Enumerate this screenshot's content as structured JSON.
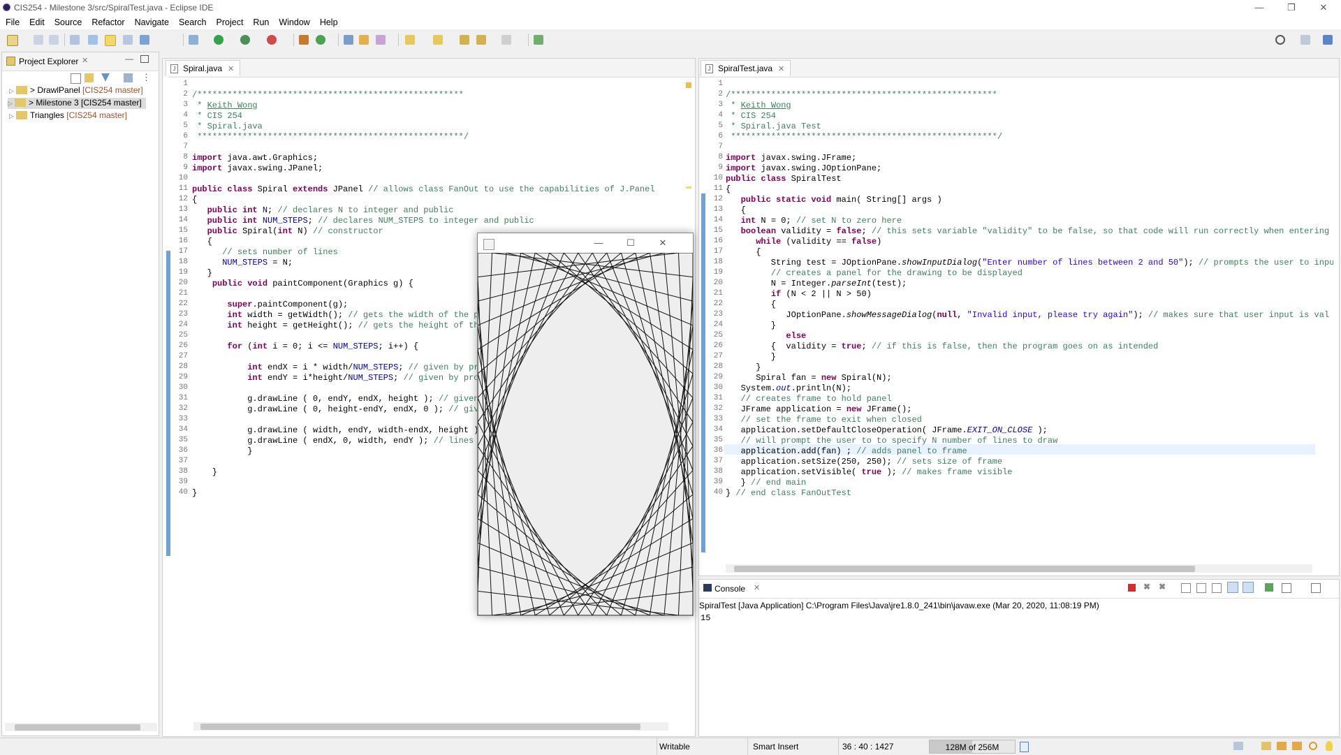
{
  "window": {
    "title": "CIS254 - Milestone 3/src/SpiralTest.java - Eclipse IDE"
  },
  "menu": [
    "File",
    "Edit",
    "Source",
    "Refactor",
    "Navigate",
    "Search",
    "Project",
    "Run",
    "Window",
    "Help"
  ],
  "explorer": {
    "title": "Project Explorer",
    "items": [
      {
        "label": "> DrawlPanel",
        "tag": "[CIS254 master]"
      },
      {
        "label": "> Milestone 3 [CIS254 master]",
        "tag": ""
      },
      {
        "label": "Triangles",
        "tag": "[CIS254 master]"
      }
    ]
  },
  "left_editor": {
    "tab": "Spiral.java",
    "lines": [
      {
        "n": "1",
        "h": ""
      },
      {
        "n": "2",
        "h": "<span class='cm'>/*****************************************************</span>"
      },
      {
        "n": "3",
        "h": "<span class='cm'> * <u>Keith Wong</u></span>"
      },
      {
        "n": "4",
        "h": "<span class='cm'> * CIS 254</span>"
      },
      {
        "n": "5",
        "h": "<span class='cm'> * Spiral.java</span>"
      },
      {
        "n": "6",
        "h": "<span class='cm'> *****************************************************/</span>"
      },
      {
        "n": "7",
        "h": ""
      },
      {
        "n": "8",
        "h": "<span class='kw'>import</span> java.awt.Graphics;"
      },
      {
        "n": "9",
        "h": "<span class='kw'>import</span> javax.swing.JPanel;"
      },
      {
        "n": "10",
        "h": ""
      },
      {
        "n": "11",
        "h": "<span class='kw'>public class</span> Spiral <span class='kw'>extends</span> JPanel <span class='cm'>// allows class FanOut to use the capabilities of J.Panel</span>"
      },
      {
        "n": "12",
        "h": "{"
      },
      {
        "n": "13",
        "h": "   <span class='kw'>public int</span> <span class='fld'>N</span>; <span class='cm'>// declares N to integer and public</span>"
      },
      {
        "n": "14",
        "h": "   <span class='kw'>public int</span> <span class='fld'>NUM_STEPS</span>; <span class='cm'>// declares NUM_STEPS to integer and public</span>"
      },
      {
        "n": "15",
        "h": "   <span class='kw'>public</span> Spiral(<span class='kw'>int</span> N) <span class='cm'>// constructor</span>"
      },
      {
        "n": "16",
        "h": "   {"
      },
      {
        "n": "17",
        "h": "      <span class='cm'>// sets number of lines</span>"
      },
      {
        "n": "18",
        "h": "      <span class='fld'>NUM_STEPS</span> = N;"
      },
      {
        "n": "19",
        "h": "   }"
      },
      {
        "n": "20",
        "h": "    <span class='kw'>public void</span> paintComponent(Graphics g) {"
      },
      {
        "n": "21",
        "h": ""
      },
      {
        "n": "22",
        "h": "       <span class='kw'>super</span>.paintComponent(g);"
      },
      {
        "n": "23",
        "h": "       <span class='kw'>int</span> width = getWidth(); <span class='cm'>// gets the width of the p</span>"
      },
      {
        "n": "24",
        "h": "       <span class='kw'>int</span> height = getHeight(); <span class='cm'>// gets the height of th</span>"
      },
      {
        "n": "25",
        "h": ""
      },
      {
        "n": "26",
        "h": "       <span class='kw'>for</span> (<span class='kw'>int</span> i = 0; i &lt;= <span class='fld'>NUM_STEPS</span>; i++) {"
      },
      {
        "n": "27",
        "h": ""
      },
      {
        "n": "28",
        "h": "           <span class='kw'>int</span> endX = i * width/<span class='fld'>NUM_STEPS</span>; <span class='cm'>// given by pr</span>"
      },
      {
        "n": "29",
        "h": "           <span class='kw'>int</span> endY = i*height/<span class='fld'>NUM_STEPS</span>; <span class='cm'>// given by pro</span>"
      },
      {
        "n": "30",
        "h": ""
      },
      {
        "n": "31",
        "h": "           g.drawLine ( 0, endY, endX, height ); <span class='cm'>// given</span>"
      },
      {
        "n": "32",
        "h": "           g.drawLine ( 0, height-endY, endX, 0 ); <span class='cm'>// giv</span>"
      },
      {
        "n": "33",
        "h": ""
      },
      {
        "n": "34",
        "h": "           g.drawLine ( width, endY, width-endX, height )"
      },
      {
        "n": "35",
        "h": "           g.drawLine ( endX, 0, width, endY ); <span class='cm'>// lines</span>"
      },
      {
        "n": "36",
        "h": "           }"
      },
      {
        "n": "37",
        "h": ""
      },
      {
        "n": "38",
        "h": "    }"
      },
      {
        "n": "39",
        "h": ""
      },
      {
        "n": "40",
        "h": "}"
      }
    ]
  },
  "right_editor": {
    "tab": "SpiralTest.java",
    "lines": [
      {
        "n": "1",
        "h": ""
      },
      {
        "n": "2",
        "h": "<span class='cm'>/*****************************************************</span>"
      },
      {
        "n": "3",
        "h": "<span class='cm'> * <u>Keith Wong</u></span>"
      },
      {
        "n": "4",
        "h": "<span class='cm'> * CIS 254</span>"
      },
      {
        "n": "5",
        "h": "<span class='cm'> * Spiral.java Test</span>"
      },
      {
        "n": "6",
        "h": "<span class='cm'> *****************************************************/</span>"
      },
      {
        "n": "7",
        "h": ""
      },
      {
        "n": "8",
        "h": "<span class='kw'>import</span> javax.swing.JFrame;"
      },
      {
        "n": "9",
        "h": "<span class='kw'>import</span> javax.swing.JOptionPane;"
      },
      {
        "n": "10",
        "h": "<span class='kw'>public class</span> SpiralTest"
      },
      {
        "n": "11",
        "h": "{"
      },
      {
        "n": "12",
        "h": "   <span class='kw'>public static void</span> main( String[] args )"
      },
      {
        "n": "13",
        "h": "   {"
      },
      {
        "n": "14",
        "h": "   <span class='kw'>int</span> N = 0; <span class='cm'>// set N to zero here</span>"
      },
      {
        "n": "15",
        "h": "   <span class='kw'>boolean</span> validity = <span class='kw'>false</span>; <span class='cm'>// this sets variable \"validity\" to be false, so that code will run correctly when entering</span>"
      },
      {
        "n": "16",
        "h": "      <span class='kw'>while</span> (validity == <span class='kw'>false</span>)"
      },
      {
        "n": "17",
        "h": "      {"
      },
      {
        "n": "18",
        "h": "         String test = JOptionPane.<span class='it'>showInputDialog</span>(<span class='st'>\"Enter number of lines between 2 and 50\"</span>); <span class='cm'>// prompts the user to inpu</span>"
      },
      {
        "n": "19",
        "h": "         <span class='cm'>// creates a panel for the drawing to be displayed</span>"
      },
      {
        "n": "20",
        "h": "         N = Integer.<span class='it'>parseInt</span>(test);"
      },
      {
        "n": "21",
        "h": "         <span class='kw'>if</span> (N &lt; 2 || N &gt; 50)"
      },
      {
        "n": "22",
        "h": "         {"
      },
      {
        "n": "23",
        "h": "            JOptionPane.<span class='it'>showMessageDialog</span>(<span class='kw'>null</span>, <span class='st'>\"Invalid input, please try again\"</span>); <span class='cm'>// makes sure that user input is val</span>"
      },
      {
        "n": "24",
        "h": "         }"
      },
      {
        "n": "25",
        "h": "            <span class='kw'>else</span>"
      },
      {
        "n": "26",
        "h": "         {  validity = <span class='kw'>true</span>; <span class='cm'>// if this is false, then the program goes on as intended</span>"
      },
      {
        "n": "27",
        "h": "         }"
      },
      {
        "n": "28",
        "h": "      }"
      },
      {
        "n": "29",
        "h": "      Spiral fan = <span class='kw'>new</span> Spiral(N);"
      },
      {
        "n": "30",
        "h": "   System.<span class='fld it'>out</span>.println(N);"
      },
      {
        "n": "31",
        "h": "   <span class='cm'>// creates frame to hold panel</span>"
      },
      {
        "n": "32",
        "h": "   JFrame application = <span class='kw'>new</span> JFrame();"
      },
      {
        "n": "33",
        "h": "   <span class='cm'>// set the frame to exit when closed</span>"
      },
      {
        "n": "34",
        "h": "   application.setDefaultCloseOperation( JFrame.<span class='fld it'>EXIT_ON_CLOSE</span> );"
      },
      {
        "n": "35",
        "h": "   <span class='cm'>// will prompt the user to to specify N number of lines to draw</span>"
      },
      {
        "n": "36",
        "h": "   application.add(fan) ; <span class='cm'>// adds panel to frame</span>"
      },
      {
        "n": "37",
        "h": "   application.setSize(250, 250); <span class='cm'>// sets size of frame</span>"
      },
      {
        "n": "38",
        "h": "   application.setVisible( <span class='kw'>true</span> ); <span class='cm'>// makes frame visible</span>"
      },
      {
        "n": "39",
        "h": "   } <span class='cm'>// end main</span>"
      },
      {
        "n": "40",
        "h": "} <span class='cm'>// end class FanOutTest</span>"
      }
    ]
  },
  "console": {
    "tab": "Console",
    "header": "SpiralTest [Java Application] C:\\Program Files\\Java\\jre1.8.0_241\\bin\\javaw.exe (Mar 20, 2020, 11:08:19 PM)",
    "output": "15"
  },
  "spiral": {
    "steps": 15
  },
  "status": {
    "writable": "Writable",
    "insert": "Smart Insert",
    "position": "36 : 40 : 1427",
    "memory": "128M of 256M",
    "memory_fraction": 0.5
  }
}
